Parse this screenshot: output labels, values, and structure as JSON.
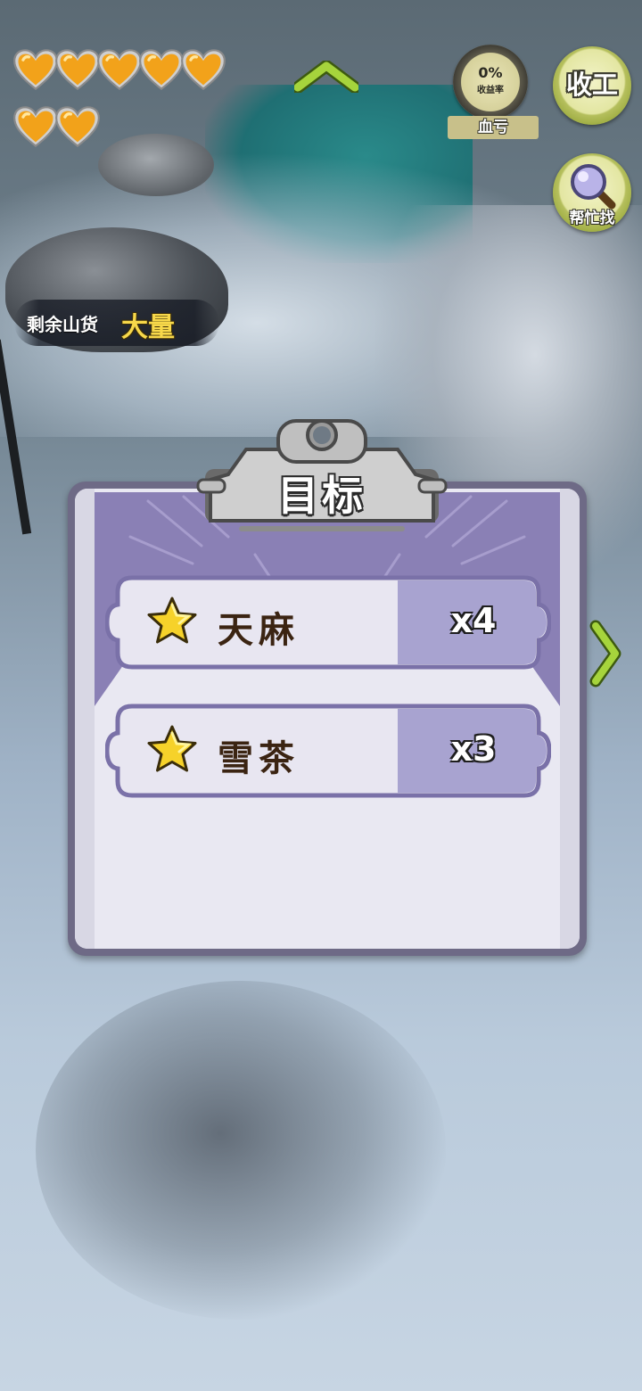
{
  "hud": {
    "lives": 7,
    "heart_icon": "heart-icon",
    "yield": {
      "percent": "0%",
      "label": "收益率",
      "status": "血亏"
    },
    "quit_button": "收工",
    "help_button": "帮忙找",
    "remaining": {
      "label": "剩余山货",
      "value": "大量"
    }
  },
  "goal": {
    "title": "目标",
    "items": [
      {
        "name": "天麻",
        "count": "x4",
        "icon": "star-icon"
      },
      {
        "name": "雪茶",
        "count": "x3",
        "icon": "star-icon"
      }
    ]
  },
  "colors": {
    "accent_green": "#9ab83a",
    "panel_purple": "#8a80b5",
    "count_cell": "#a8a3d0",
    "heart_orange": "#f2a21a"
  }
}
